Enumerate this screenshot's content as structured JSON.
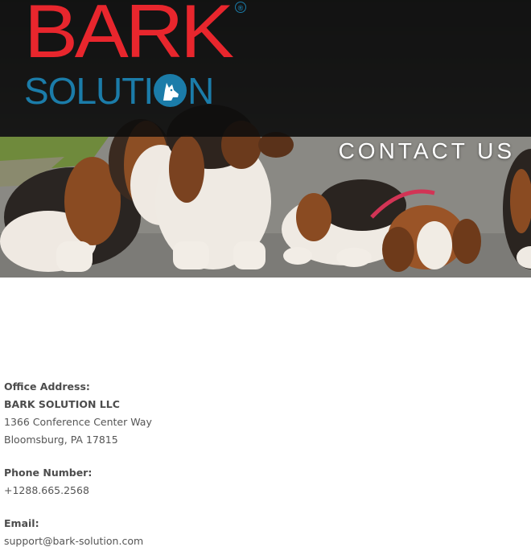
{
  "header": {
    "logo": {
      "word_top": "BARK",
      "word_bottom": "SOLUTION",
      "registered_mark": "®",
      "colors": {
        "red": "#e8262d",
        "blue": "#1b7ca9"
      }
    },
    "hero_image": "basset-hound-dogs-lying-on-road",
    "page_title": "CONTACT US"
  },
  "contact": {
    "office_label": "Office Address:",
    "company": "BARK SOLUTION LLC",
    "street": "1366 Conference Center Way",
    "city": "Bloomsburg, PA 17815",
    "phone_label": "Phone Number:",
    "phone": "+1288.665.2568",
    "email_label": "Email:",
    "email": "support@bark-solution.com"
  }
}
